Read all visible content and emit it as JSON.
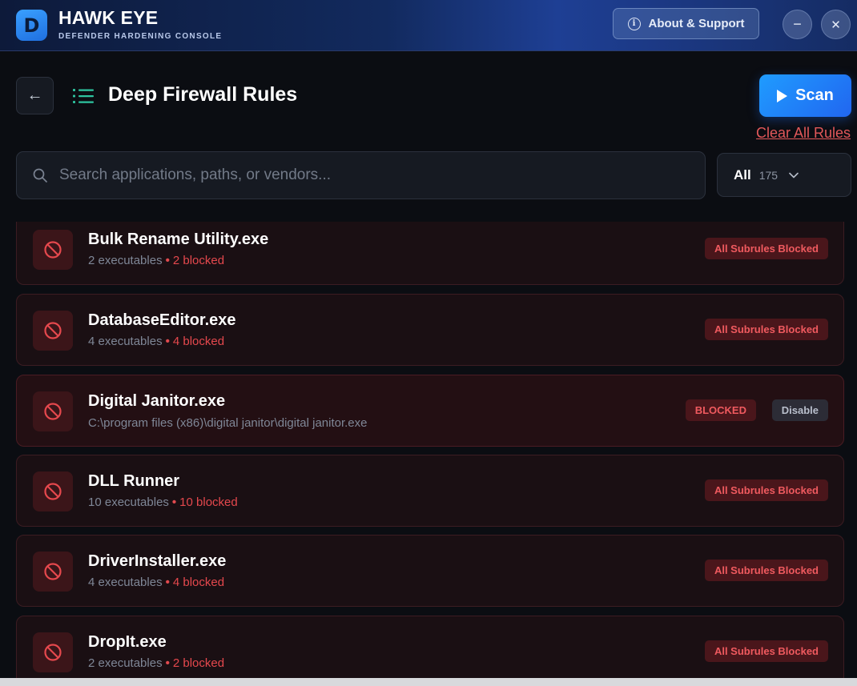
{
  "app": {
    "logo_letter": "D",
    "title": "HAWK EYE",
    "subtitle": "DEFENDER HARDENING CONSOLE",
    "about_label": "About & Support",
    "minimize_glyph": "−",
    "close_glyph": "✕"
  },
  "page": {
    "back_glyph": "←",
    "title": "Deep Firewall Rules",
    "scan_label": "Scan",
    "clear_label": "Clear All Rules"
  },
  "search": {
    "placeholder": "Search applications, paths, or vendors...",
    "value": ""
  },
  "filter": {
    "selected": "All",
    "count": "175"
  },
  "rules": [
    {
      "name": "Bulk Rename Utility.exe",
      "executables": "2 executables",
      "dot": "•",
      "blocked": "2 blocked",
      "badge": "All Subrules Blocked"
    },
    {
      "name": "DatabaseEditor.exe",
      "executables": "4 executables",
      "dot": "•",
      "blocked": "4 blocked",
      "badge": "All Subrules Blocked"
    },
    {
      "name": "Digital Janitor.exe",
      "path": "C:\\program files (x86)\\digital janitor\\digital janitor.exe",
      "badge": "BLOCKED",
      "action": "Disable"
    },
    {
      "name": "DLL Runner",
      "executables": "10 executables",
      "dot": "•",
      "blocked": "10 blocked",
      "badge": "All Subrules Blocked"
    },
    {
      "name": "DriverInstaller.exe",
      "executables": "4 executables",
      "dot": "•",
      "blocked": "4 blocked",
      "badge": "All Subrules Blocked"
    },
    {
      "name": "DropIt.exe",
      "executables": "2 executables",
      "dot": "•",
      "blocked": "2 blocked",
      "badge": "All Subrules Blocked"
    }
  ],
  "colors": {
    "accent_blue": "#2166f0",
    "danger_red": "#e5484d",
    "list_icon_green": "#2ec4a0"
  },
  "icons": {
    "rule": "blocked-circle-icon",
    "search": "search-icon",
    "list": "list-icon",
    "info": "info-icon",
    "chevron": "chevron-down-icon"
  }
}
